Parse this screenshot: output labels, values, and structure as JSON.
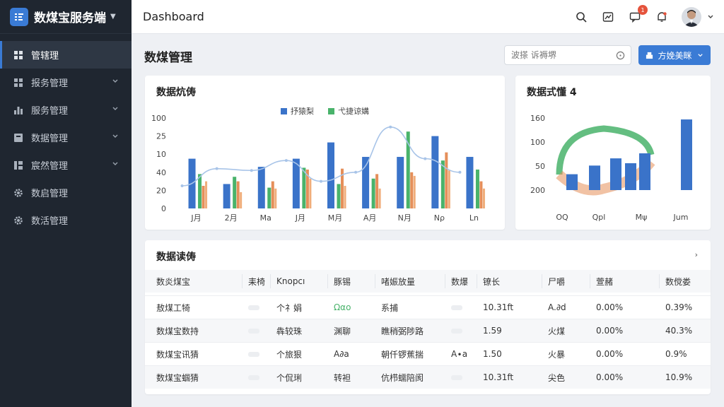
{
  "app": {
    "brand": "数煤宝服务端"
  },
  "sidebar": {
    "items": [
      {
        "label": "管辖理",
        "icon": "dashboard-icon",
        "active": true,
        "has_chevron": false
      },
      {
        "label": "报务管理",
        "icon": "grid-icon",
        "active": false,
        "has_chevron": true
      },
      {
        "label": "服务管理",
        "icon": "bar-chart-icon",
        "active": false,
        "has_chevron": true
      },
      {
        "label": "数据管理",
        "icon": "database-icon",
        "active": false,
        "has_chevron": true
      },
      {
        "label": "宸然管理",
        "icon": "module-icon",
        "active": false,
        "has_chevron": true
      },
      {
        "label": "数启管理",
        "icon": "gear-icon",
        "active": false,
        "has_chevron": false
      },
      {
        "label": "数活管理",
        "icon": "gear-icon",
        "active": false,
        "has_chevron": false
      }
    ]
  },
  "topbar": {
    "title": "Dashboard",
    "notification_count": "1"
  },
  "page": {
    "title": "数煤管理",
    "search_placeholder": "波搽 诉褥堺",
    "primary_button": "方娩美眯"
  },
  "cards": {
    "bar_chart_title": "数据炕俦",
    "gauge_chart_title": "数据式懂 4",
    "table_title": "数据读俦",
    "table_more": "›"
  },
  "chart_data": [
    {
      "type": "bar",
      "title": "数据炕俦",
      "legend": [
        "抒猿梨",
        "弋捷谅媾"
      ],
      "categories": [
        "J月",
        "2月",
        "Ma",
        "J月",
        "M月",
        "A月",
        "N月",
        "Nρ",
        "Ln"
      ],
      "y_ticks": [
        "100",
        "25",
        "10",
        "40",
        "20",
        "0"
      ],
      "series": [
        {
          "name": "抒猿梨",
          "color": "#3a73c9",
          "values": [
            55,
            27,
            46,
            55,
            73,
            57,
            57,
            80,
            57
          ]
        },
        {
          "name": "弋捷谅媾",
          "color": "#49b36b",
          "values": [
            38,
            35,
            23,
            45,
            27,
            33,
            85,
            53,
            43
          ]
        },
        {
          "color": "#e58f5a",
          "values": [
            25,
            30,
            30,
            43,
            44,
            38,
            40,
            62,
            30
          ]
        },
        {
          "color": "#f0ad7a",
          "values": [
            30,
            18,
            22,
            33,
            25,
            22,
            36,
            42,
            22
          ]
        }
      ],
      "line": {
        "color": "#a8c4e8",
        "values": [
          25,
          44,
          42,
          53,
          30,
          40,
          90,
          55,
          40
        ]
      },
      "grid": false,
      "legend_position": "top-center"
    },
    {
      "type": "bar",
      "title": "数据式懂 4",
      "categories": [
        "OQ",
        "Qpl",
        "Mψ",
        "Jum"
      ],
      "y_ticks": [
        "160",
        "100",
        "50",
        "200"
      ],
      "series": [
        {
          "color": "#3a73c9",
          "values": [
            22,
            34,
            44,
            98
          ]
        }
      ],
      "arc_colors": [
        "#49b36b",
        "#e58f5a",
        "#3a73c9"
      ]
    }
  ],
  "table": {
    "columns": [
      "数炎煤宝",
      "耒椅",
      "Knopcı",
      "豚锡",
      "啫娠放量",
      "数爆",
      "镣长",
      "尸嚼",
      "萱赭",
      "数傥娄"
    ],
    "rows": [
      [
        "敖煤工犄",
        "",
        "个礻娟",
        "Ωαo",
        "系捕",
        "",
        "10.31ft",
        "A.∂d",
        "0.00%",
        "0.39%"
      ],
      [
        "数煤宝数持",
        "",
        "犇较珠",
        "渊聊",
        "瞧稍弼陟路",
        "",
        "1.59",
        "火煤",
        "0.00%",
        "40.3%"
      ],
      [
        "数煤宝讯猜",
        "",
        "个旅狠",
        "A∂a",
        "朝仟锣蕉揣",
        "A∙a",
        "1.50",
        "火暴",
        "0.00%",
        "0.9%"
      ],
      [
        "数煤宝蝈猜",
        "",
        "个侃琍",
        "转袒",
        "伉栉蠕陪阂",
        "",
        "10.31ft",
        "尖色",
        "0.00%",
        "10.9%"
      ]
    ]
  }
}
